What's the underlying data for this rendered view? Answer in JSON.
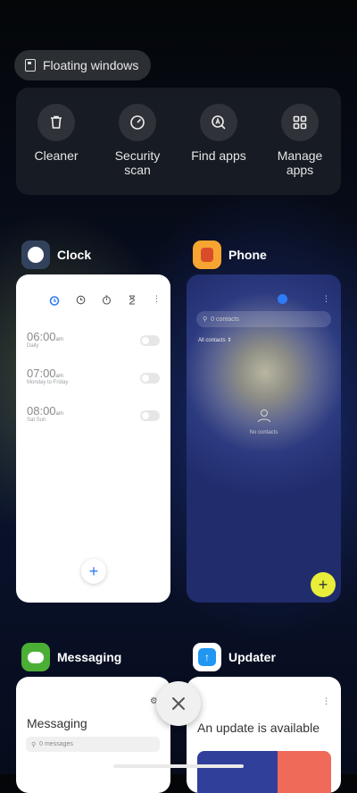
{
  "floating_windows": {
    "label": "Floating windows"
  },
  "quick_tools": [
    {
      "label": "Cleaner",
      "icon": "trash-icon"
    },
    {
      "label": "Security scan",
      "icon": "speedometer-icon"
    },
    {
      "label": "Find apps",
      "icon": "search-a-icon"
    },
    {
      "label": "Manage apps",
      "icon": "grid-icon"
    }
  ],
  "apps": {
    "clock": {
      "name": "Clock",
      "alarms": [
        {
          "time": "06:00",
          "ampm": "am",
          "repeat": "Daily"
        },
        {
          "time": "07:00",
          "ampm": "am",
          "repeat": "Monday to Friday"
        },
        {
          "time": "08:00",
          "ampm": "am",
          "repeat": "Sat Sun"
        }
      ],
      "fab": "+"
    },
    "phone": {
      "name": "Phone",
      "search_placeholder": "0 contacts",
      "filter": "All contacts",
      "empty": "No contacts",
      "fab": "+"
    },
    "messaging": {
      "name": "Messaging",
      "title": "Messaging",
      "search_placeholder": "0 messages"
    },
    "updater": {
      "name": "Updater",
      "message": "An update is available"
    }
  },
  "colors": {
    "clock_accent": "#2e7cf6",
    "phone_fab": "#e8ee3a",
    "messaging_icon": "#4caf35",
    "updater_icon": "#2196f3"
  }
}
